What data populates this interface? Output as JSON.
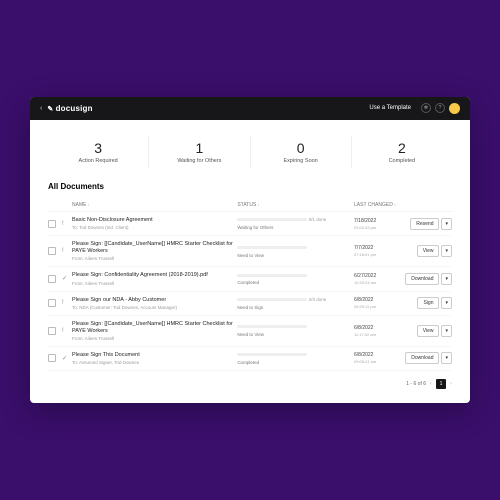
{
  "topbar": {
    "brand": "docusign",
    "template": "Use a Template"
  },
  "stats": [
    {
      "n": "3",
      "l": "Action Required"
    },
    {
      "n": "1",
      "l": "Waiting for Others"
    },
    {
      "n": "0",
      "l": "Expiring Soon"
    },
    {
      "n": "2",
      "l": "Completed"
    }
  ],
  "section": "All Documents",
  "cols": {
    "name": "NAME",
    "status": "STATUS",
    "last": "LAST CHANGED"
  },
  "rows": [
    {
      "icon": "!",
      "name": "Basic Non-Disclosure Agreement",
      "sub": "To: Tod Downes (Ind. Client)",
      "pct": 20,
      "stlabel": "Waiting for Others",
      "done": "0/1 done",
      "d1": "7/18/2022",
      "d2": "03:02:43 pm",
      "act": "Resend"
    },
    {
      "icon": "!",
      "name": "Please Sign: [[Candidate_UserName]] HMRC Starter Checklist for PAYE Workers",
      "sub": "From: Aileen Trussell",
      "pct": 50,
      "stlabel": "Need to View",
      "done": "",
      "d1": "7/7/2022",
      "d2": "07:18:01 pm",
      "act": "View"
    },
    {
      "icon": "✓",
      "name": "Please Sign: Confidentiality Agreement (2018-2019).pdf",
      "sub": "From: Aileen Trussell",
      "pct": 100,
      "stlabel": "Completed",
      "done": "",
      "d1": "6/27/2022",
      "d2": "10:33:24 am",
      "act": "Download"
    },
    {
      "icon": "!",
      "name": "Please Sign our NDA - Abby Customer",
      "sub": "To: NDA (Customer: Tod Downes, Account Manager)",
      "pct": 60,
      "stlabel": "Need to Sign",
      "done": "2/3 done",
      "d1": "6/8/2022",
      "d2": "05:29:11 pm",
      "act": "Sign"
    },
    {
      "icon": "!",
      "name": "Please Sign: [[Candidate_UserName]] HMRC Starter Checklist for PAYE Workers",
      "sub": "From: Aileen Trussell",
      "pct": 50,
      "stlabel": "Need to View",
      "done": "",
      "d1": "6/8/2022",
      "d2": "11:17:02 am",
      "act": "View"
    },
    {
      "icon": "✓",
      "name": "Please Sign This Document",
      "sub": "To: Assumed Signer, Tod Downes",
      "pct": 100,
      "stlabel": "Completed",
      "done": "",
      "d1": "6/8/2022",
      "d2": "09:08:41 am",
      "act": "Download"
    }
  ],
  "pager": {
    "range": "1 - 6 of 6",
    "page": "1"
  }
}
